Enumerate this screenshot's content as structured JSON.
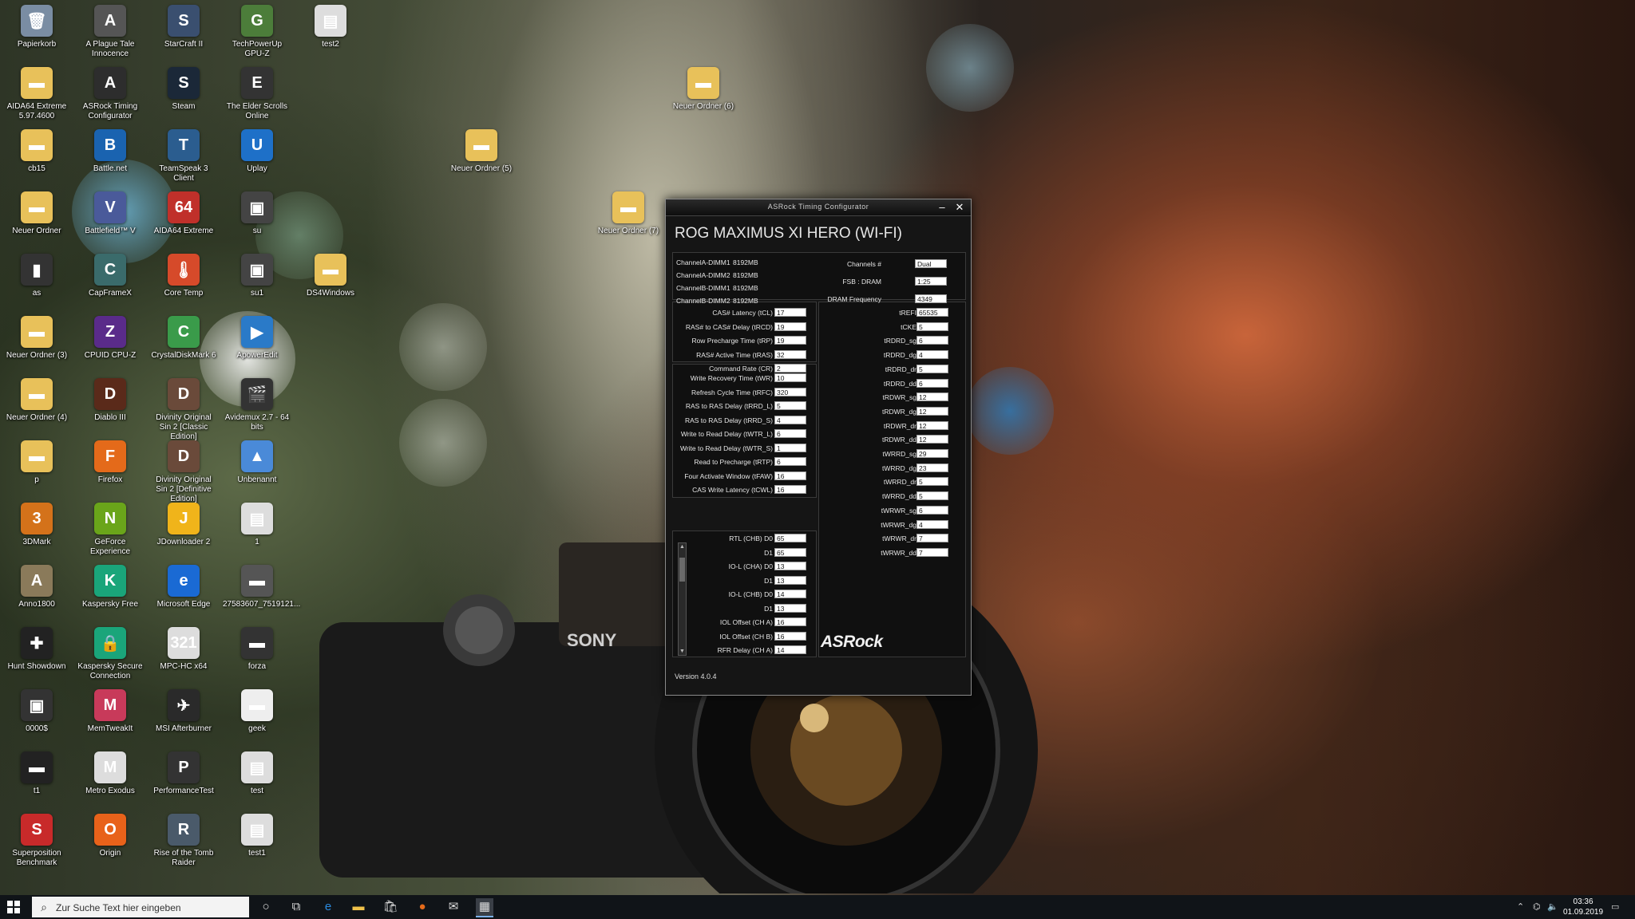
{
  "desktop": {
    "icons": [
      {
        "label": "Papierkorb",
        "icon": "recycle-bin-icon",
        "color": "#7a8da3",
        "g": "🗑"
      },
      {
        "label": "A Plague Tale Innocence",
        "icon": "game-icon",
        "color": "#555555",
        "g": "A"
      },
      {
        "label": "StarCraft II",
        "icon": "game-icon",
        "color": "#3a4f6f",
        "g": "S"
      },
      {
        "label": "TechPowerUp GPU-Z",
        "icon": "gpu-icon",
        "color": "#4c7d3a",
        "g": "G"
      },
      {
        "label": "test2",
        "icon": "file-icon",
        "color": "#dddddd",
        "g": "▤"
      },
      {
        "label": "AIDA64 Extreme 5.97.4600",
        "icon": "folder-icon",
        "color": "#e8c15a",
        "g": "▬"
      },
      {
        "label": "ASRock Timing Configurator",
        "icon": "app-icon",
        "color": "#2d2d2d",
        "g": "A"
      },
      {
        "label": "Steam",
        "icon": "steam-icon",
        "color": "#1b2838",
        "g": "S"
      },
      {
        "label": "The Elder Scrolls Online",
        "icon": "game-icon",
        "color": "#333333",
        "g": "E"
      },
      {
        "label": "cb15",
        "icon": "folder-icon",
        "color": "#e8c15a",
        "g": "▬"
      },
      {
        "label": "Battle.net",
        "icon": "battlenet-icon",
        "color": "#1a63b0",
        "g": "B"
      },
      {
        "label": "TeamSpeak 3 Client",
        "icon": "teamspeak-icon",
        "color": "#2b5d8f",
        "g": "T"
      },
      {
        "label": "Uplay",
        "icon": "uplay-icon",
        "color": "#1e70c8",
        "g": "U"
      },
      {
        "label": "Neuer Ordner",
        "icon": "folder-icon",
        "color": "#e8c15a",
        "g": "▬"
      },
      {
        "label": "Battlefield™ V",
        "icon": "game-icon",
        "color": "#4a5a9a",
        "g": "V"
      },
      {
        "label": "AIDA64 Extreme",
        "icon": "aida-icon",
        "color": "#c0302a",
        "g": "64"
      },
      {
        "label": "su",
        "icon": "file-icon",
        "color": "#444444",
        "g": "▣"
      },
      {
        "label": "as",
        "icon": "file-icon",
        "color": "#333333",
        "g": "▮"
      },
      {
        "label": "CapFrameX",
        "icon": "app-icon",
        "color": "#3a6b6b",
        "g": "C"
      },
      {
        "label": "Core Temp",
        "icon": "thermometer-icon",
        "color": "#d64a2a",
        "g": "🌡"
      },
      {
        "label": "su1",
        "icon": "file-icon",
        "color": "#444444",
        "g": "▣"
      },
      {
        "label": "DS4Windows",
        "icon": "folder-icon",
        "color": "#e8c15a",
        "g": "▬"
      },
      {
        "label": "Neuer Ordner (3)",
        "icon": "folder-icon",
        "color": "#e8c15a",
        "g": "▬"
      },
      {
        "label": "CPUID CPU-Z",
        "icon": "cpu-icon",
        "color": "#5a2b8a",
        "g": "Z"
      },
      {
        "label": "CrystalDiskMark 6",
        "icon": "disk-icon",
        "color": "#3a9b4a",
        "g": "C"
      },
      {
        "label": "ApowerEdit",
        "icon": "video-icon",
        "color": "#2a7ac8",
        "g": "▶"
      },
      {
        "label": "Neuer Ordner (4)",
        "icon": "folder-icon",
        "color": "#e8c15a",
        "g": "▬"
      },
      {
        "label": "Diablo III",
        "icon": "game-icon",
        "color": "#5a2a1a",
        "g": "D"
      },
      {
        "label": "Divinity Original Sin 2 [Classic Edition]",
        "icon": "game-icon",
        "color": "#6a4a3a",
        "g": "D"
      },
      {
        "label": "Avidemux 2.7 - 64 bits",
        "icon": "video-icon",
        "color": "#333333",
        "g": "🎬"
      },
      {
        "label": "p",
        "icon": "folder-icon",
        "color": "#e8c15a",
        "g": "▬"
      },
      {
        "label": "Firefox",
        "icon": "firefox-icon",
        "color": "#e46a1a",
        "g": "F"
      },
      {
        "label": "Divinity Original Sin 2 [Definitive Edition]",
        "icon": "game-icon",
        "color": "#6a4a3a",
        "g": "D"
      },
      {
        "label": "Unbenannt",
        "icon": "image-icon",
        "color": "#4a8ad8",
        "g": "▲"
      },
      {
        "label": "3DMark",
        "icon": "game-icon",
        "color": "#d4721a",
        "g": "3"
      },
      {
        "label": "GeForce Experience",
        "icon": "nvidia-icon",
        "color": "#6aa51a",
        "g": "N"
      },
      {
        "label": "JDownloader 2",
        "icon": "download-icon",
        "color": "#f0b41a",
        "g": "J"
      },
      {
        "label": "1",
        "icon": "file-icon",
        "color": "#dddddd",
        "g": "▤"
      },
      {
        "label": "Anno1800",
        "icon": "game-icon",
        "color": "#8a7a5a",
        "g": "A"
      },
      {
        "label": "Kaspersky Free",
        "icon": "kaspersky-icon",
        "color": "#1aa57a",
        "g": "K"
      },
      {
        "label": "Microsoft Edge",
        "icon": "edge-icon",
        "color": "#1a6ad4",
        "g": "e"
      },
      {
        "label": "27583607_7519121...",
        "icon": "image-icon",
        "color": "#555555",
        "g": "▬"
      },
      {
        "label": "Hunt Showdown",
        "icon": "game-icon",
        "color": "#222222",
        "g": "✚"
      },
      {
        "label": "Kaspersky Secure Connection",
        "icon": "kaspersky-icon",
        "color": "#1aa57a",
        "g": "🔒"
      },
      {
        "label": "MPC-HC x64",
        "icon": "video-icon",
        "color": "#dddddd",
        "g": "321"
      },
      {
        "label": "forza",
        "icon": "file-icon",
        "color": "#333333",
        "g": "▬"
      },
      {
        "label": "0000$",
        "icon": "file-icon",
        "color": "#333333",
        "g": "▣"
      },
      {
        "label": "MemTweakIt",
        "icon": "app-icon",
        "color": "#c83a5a",
        "g": "M"
      },
      {
        "label": "MSI Afterburner",
        "icon": "afterburner-icon",
        "color": "#2a2a2a",
        "g": "✈"
      },
      {
        "label": "geek",
        "icon": "file-icon",
        "color": "#eeeeee",
        "g": "▬"
      },
      {
        "label": "t1",
        "icon": "file-icon",
        "color": "#222222",
        "g": "▬"
      },
      {
        "label": "Metro Exodus",
        "icon": "game-icon",
        "color": "#dddddd",
        "g": "M"
      },
      {
        "label": "PerformanceTest",
        "icon": "app-icon",
        "color": "#333333",
        "g": "P"
      },
      {
        "label": "test",
        "icon": "file-icon",
        "color": "#dddddd",
        "g": "▤"
      },
      {
        "label": "Superposition Benchmark",
        "icon": "game-icon",
        "color": "#c82a2a",
        "g": "S"
      },
      {
        "label": "Origin",
        "icon": "origin-icon",
        "color": "#e8621a",
        "g": "O"
      },
      {
        "label": "Rise of the Tomb Raider",
        "icon": "game-icon",
        "color": "#4a5a6a",
        "g": "R"
      },
      {
        "label": "test1",
        "icon": "file-icon",
        "color": "#dddddd",
        "g": "▤"
      }
    ],
    "extra_icons": [
      {
        "label": "Neuer Ordner (6)",
        "icon": "folder-icon",
        "color": "#e8c15a",
        "g": "▬"
      },
      {
        "label": "Neuer Ordner (5)",
        "icon": "folder-icon",
        "color": "#e8c15a",
        "g": "▬"
      },
      {
        "label": "Neuer Ordner (7)",
        "icon": "folder-icon",
        "color": "#e8c15a",
        "g": "▬"
      }
    ]
  },
  "window": {
    "title": "ASRock Timing Configurator",
    "minimize": "–",
    "close": "✕",
    "board": "ROG MAXIMUS XI HERO (WI-FI)",
    "dimms": [
      {
        "slot": "ChannelA-DIMM1",
        "size": "8192MB"
      },
      {
        "slot": "ChannelA-DIMM2",
        "size": "8192MB"
      },
      {
        "slot": "ChannelB-DIMM1",
        "size": "8192MB"
      },
      {
        "slot": "ChannelB-DIMM2",
        "size": "8192MB"
      }
    ],
    "info": [
      {
        "label": "Channels #",
        "value": "Dual"
      },
      {
        "label": "FSB : DRAM",
        "value": "1:25"
      },
      {
        "label": "DRAM Frequency",
        "value": "4349"
      }
    ],
    "primary": [
      {
        "label": "CAS# Latency (tCL)",
        "value": "17"
      },
      {
        "label": "RAS# to CAS# Delay (tRCD)",
        "value": "19"
      },
      {
        "label": "Row Precharge Time (tRP)",
        "value": "19"
      },
      {
        "label": "RAS# Active Time (tRAS)",
        "value": "32"
      },
      {
        "label": "Command Rate (CR)",
        "value": "2"
      }
    ],
    "secondary": [
      {
        "label": "Write Recovery Time (tWR)",
        "value": "10"
      },
      {
        "label": "Refresh Cycle Time (tRFC)",
        "value": "320"
      },
      {
        "label": "RAS to RAS Delay (tRRD_L)",
        "value": "5"
      },
      {
        "label": "RAS to RAS Delay (tRRD_S)",
        "value": "4"
      },
      {
        "label": "Write to Read Delay (tWTR_L)",
        "value": "6"
      },
      {
        "label": "Write to Read Delay (tWTR_S)",
        "value": "1"
      },
      {
        "label": "Read to Precharge (tRTP)",
        "value": "6"
      },
      {
        "label": "Four Activate Window (tFAW)",
        "value": "16"
      },
      {
        "label": "CAS Write Latency (tCWL)",
        "value": "16"
      }
    ],
    "rtl": [
      {
        "label": "RTL (CHB) D0",
        "value": "65"
      },
      {
        "label": "D1",
        "value": "65"
      },
      {
        "label": "IO-L (CHA) D0",
        "value": "13"
      },
      {
        "label": "D1",
        "value": "13"
      },
      {
        "label": "IO-L (CHB) D0",
        "value": "14"
      },
      {
        "label": "D1",
        "value": "13"
      },
      {
        "label": "IOL Offset (CH A)",
        "value": "16"
      },
      {
        "label": "IOL Offset (CH B)",
        "value": "16"
      },
      {
        "label": "RFR Delay (CH A)",
        "value": "14"
      },
      {
        "label": "RFR Delay (CH B)",
        "value": "14"
      }
    ],
    "tertiary": [
      {
        "label": "tREFI",
        "value": "65535"
      },
      {
        "label": "tCKE",
        "value": "5"
      },
      {
        "label": "tRDRD_sg",
        "value": "6"
      },
      {
        "label": "tRDRD_dg",
        "value": "4"
      },
      {
        "label": "tRDRD_dr",
        "value": "5"
      },
      {
        "label": "tRDRD_dd",
        "value": "6"
      },
      {
        "label": "tRDWR_sg",
        "value": "12"
      },
      {
        "label": "tRDWR_dg",
        "value": "12"
      },
      {
        "label": "tRDWR_dr",
        "value": "12"
      },
      {
        "label": "tRDWR_dd",
        "value": "12"
      },
      {
        "label": "tWRRD_sg",
        "value": "29"
      },
      {
        "label": "tWRRD_dg",
        "value": "23"
      },
      {
        "label": "tWRRD_dr",
        "value": "5"
      },
      {
        "label": "tWRRD_dd",
        "value": "5"
      },
      {
        "label": "tWRWR_sg",
        "value": "6"
      },
      {
        "label": "tWRWR_dg",
        "value": "4"
      },
      {
        "label": "tWRWR_dr",
        "value": "7"
      },
      {
        "label": "tWRWR_dd",
        "value": "7"
      }
    ],
    "logo": "ASRock",
    "version": "Version 4.0.4"
  },
  "taskbar": {
    "search_placeholder": "Zur Suche Text hier eingeben",
    "time": "03:36",
    "date": "01.09.2019"
  }
}
